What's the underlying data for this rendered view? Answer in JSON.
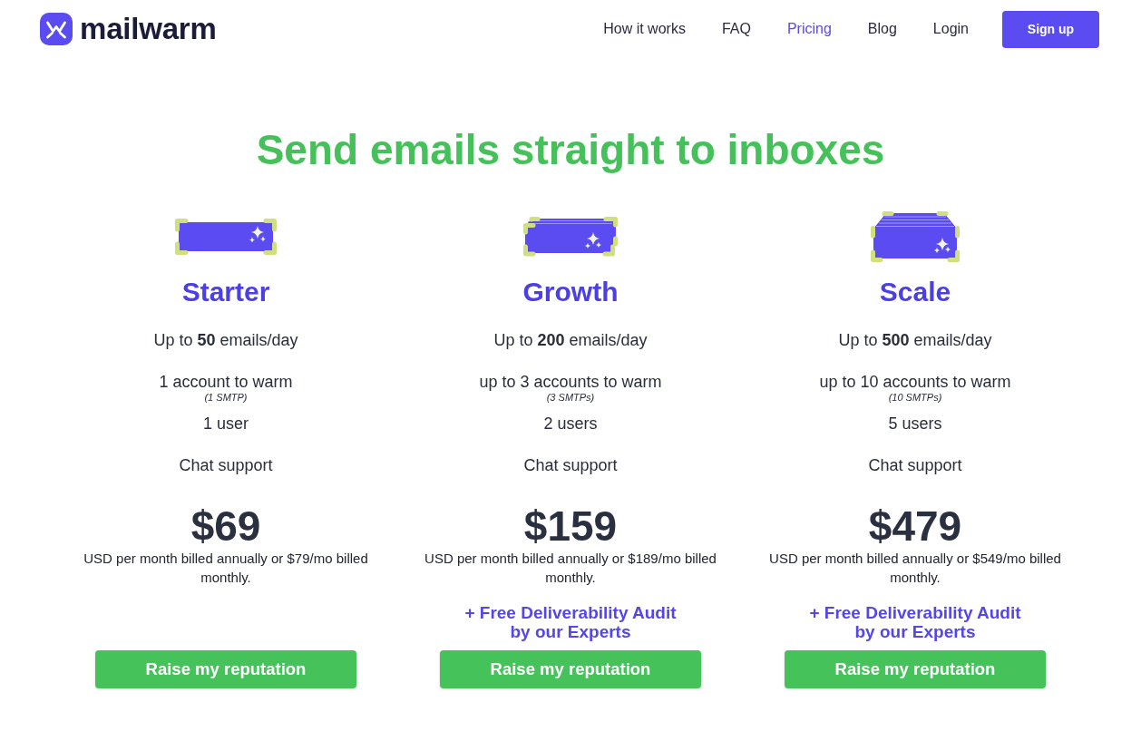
{
  "header": {
    "logo": "mailwarm",
    "nav": [
      {
        "label": "How it works",
        "selected": false
      },
      {
        "label": "FAQ",
        "selected": false
      },
      {
        "label": "Pricing",
        "selected": true
      },
      {
        "label": "Blog",
        "selected": false
      },
      {
        "label": "Login",
        "selected": false
      }
    ],
    "signup_button": "Sign up"
  },
  "headline": "Send emails straight to inboxes",
  "plans": [
    {
      "kind": "single",
      "name": "Starter",
      "features": [
        {
          "text": "Up to **50** emails/day"
        },
        {
          "text": "1 account to warm",
          "note": "(1 SMTP)"
        },
        {
          "text": "1 user"
        },
        {
          "text": "Chat support"
        }
      ],
      "price": "$69",
      "billing_note": "USD per month billed annually or $79/mo billed monthly.",
      "cta": "Raise my reputation"
    },
    {
      "kind": "stack",
      "name": "Growth",
      "features": [
        {
          "text": "Up to **200** emails/day"
        },
        {
          "text": "up to 3 accounts to warm",
          "note": "(3 SMTPs)"
        },
        {
          "text": "2 users"
        },
        {
          "text": "Chat support"
        }
      ],
      "price": "$159",
      "billing_note": "USD per month billed annually or $189/mo billed monthly.",
      "bonus": "+ Free Deliverability Audit by our Experts",
      "cta": "Raise my reputation"
    },
    {
      "kind": "pile",
      "name": "Scale",
      "features": [
        {
          "text": "Up to **500** emails/day"
        },
        {
          "text": "up to 10 accounts to warm",
          "note": "(10 SMTPs)"
        },
        {
          "text": "5 users"
        },
        {
          "text": "Chat support"
        }
      ],
      "price": "$479",
      "billing_note": "USD per month billed annually or $549/mo billed monthly.",
      "bonus": "+ Free Deliverability Audit by our Experts",
      "cta": "Raise my reputation"
    }
  ]
}
